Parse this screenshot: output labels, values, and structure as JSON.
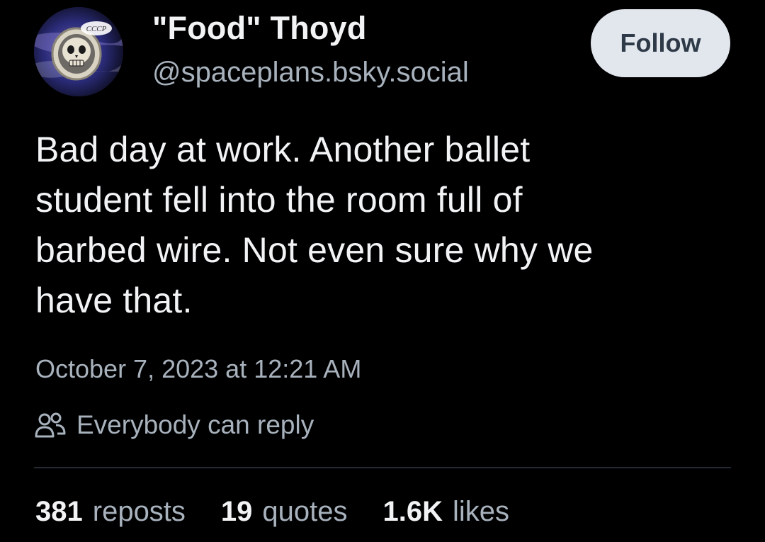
{
  "author": {
    "display_name": "\"Food\" Thoyd",
    "handle": "@spaceplans.bsky.social",
    "avatar_icon": "astronaut-skull-avatar",
    "avatar_badge_text": "CCCP"
  },
  "actions": {
    "follow_label": "Follow"
  },
  "post": {
    "text": "Bad day at work. Another ballet\nstudent fell into the room full of\nbarbed wire. Not even sure why we\nhave that.",
    "timestamp": "October 7, 2023 at 12:21 AM",
    "reply_setting": "Everybody can reply",
    "reply_icon": "people-icon"
  },
  "stats": [
    {
      "count": "381",
      "label": "reposts"
    },
    {
      "count": "19",
      "label": "quotes"
    },
    {
      "count": "1.6K",
      "label": "likes"
    }
  ],
  "colors": {
    "background": "#000000",
    "primary_text": "#f1f3f5",
    "secondary_text": "#a8b2bd",
    "follow_button_bg": "#e2e7ee",
    "divider": "#232a33"
  }
}
